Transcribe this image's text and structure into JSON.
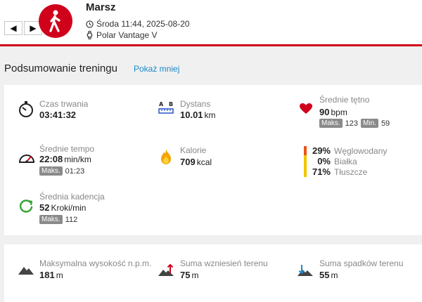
{
  "header": {
    "sport": "Marsz",
    "date": "Środa 11:44, 2025-08-20",
    "device": "Polar Vantage V",
    "nav": {
      "prev": "◀",
      "next": "▶"
    }
  },
  "summary": {
    "title": "Podsumowanie treningu",
    "toggle": "Pokaż mniej",
    "duration": {
      "label": "Czas trwania",
      "value": "03:41:32"
    },
    "distance": {
      "label": "Dystans",
      "value": "10.01",
      "unit": "km"
    },
    "heart_rate": {
      "label": "Średnie tętno",
      "value": "90",
      "unit": "bpm",
      "max_tag": "Maks.",
      "max": "123",
      "min_tag": "Min.",
      "min": "59"
    },
    "pace": {
      "label": "Średnie tempo",
      "value": "22:08",
      "unit": "min/km",
      "max_tag": "Maks.",
      "max": "01:23"
    },
    "calories": {
      "label": "Kalorie",
      "value": "709",
      "unit": "kcal"
    },
    "macros": [
      {
        "pct": "29%",
        "name": "Węglowodany"
      },
      {
        "pct": "0%",
        "name": "Białka"
      },
      {
        "pct": "71%",
        "name": "Tłuszcze"
      }
    ],
    "cadence": {
      "label": "Średnia kadencja",
      "value": "52",
      "unit": "Kroki/min",
      "max_tag": "Maks.",
      "max": "112"
    }
  },
  "elevation": {
    "max_altitude": {
      "label": "Maksymalna wysokość n.p.m.",
      "value": "181",
      "unit": "m"
    },
    "ascent": {
      "label": "Suma wzniesień terenu",
      "value": "75",
      "unit": "m"
    },
    "descent": {
      "label": "Suma spadków terenu",
      "value": "55",
      "unit": "m"
    }
  },
  "colors": {
    "accent": "#d0021b",
    "link": "#1a88c9",
    "carbs": "#e8561a",
    "fat": "#f2c400",
    "cadence": "#3aa53a"
  }
}
